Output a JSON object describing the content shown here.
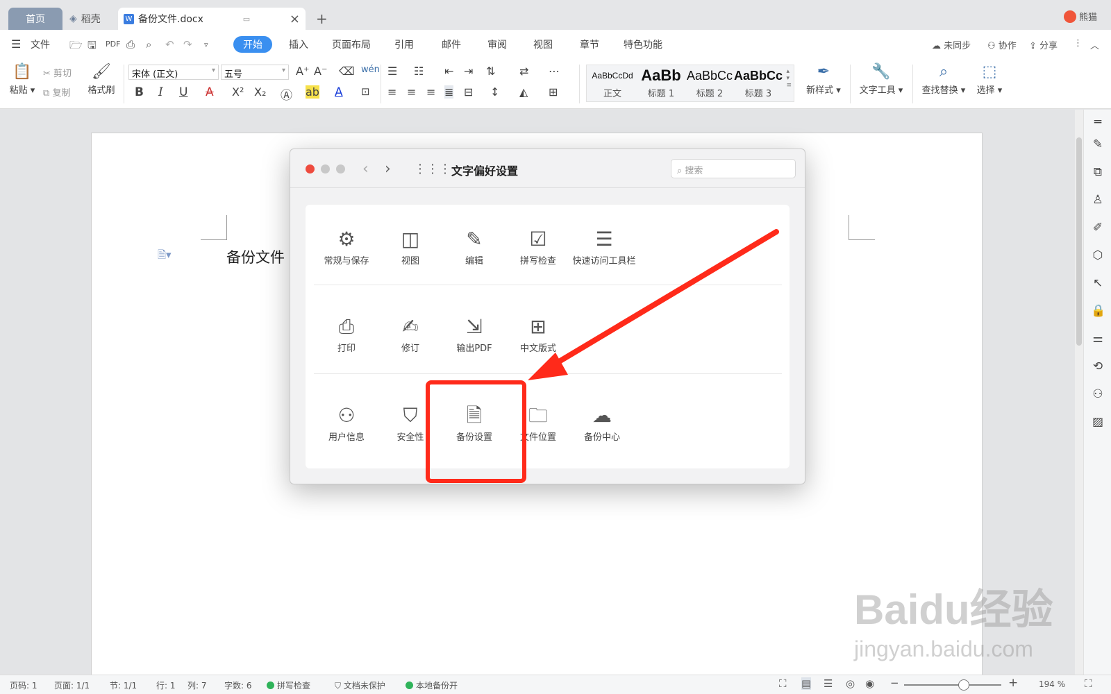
{
  "tabs": {
    "home": "首页",
    "daoke": "稻壳",
    "doc": "备份文件.docx",
    "plus": "+"
  },
  "user": {
    "name": "熊猫"
  },
  "menu": {
    "file": "文件",
    "items": [
      "开始",
      "插入",
      "页面布局",
      "引用",
      "邮件",
      "审阅",
      "视图",
      "章节",
      "特色功能"
    ],
    "right": [
      "未同步",
      "协作",
      "分享"
    ]
  },
  "ribbon": {
    "paste": "粘贴",
    "cut": "剪切",
    "copy": "复制",
    "format_painter": "格式刷",
    "font_name": "宋体 (正文)",
    "font_size": "五号",
    "styles": [
      {
        "sample": "AaBbCcDd",
        "label": "正文"
      },
      {
        "sample": "AaBb",
        "label": "标题 1"
      },
      {
        "sample": "AaBbCc",
        "label": "标题 2"
      },
      {
        "sample": "AaBbCc",
        "label": "标题 3"
      }
    ],
    "new_style": "新样式",
    "text_tools": "文字工具",
    "find_replace": "查找替换",
    "select": "选择"
  },
  "document": {
    "text": "备份文件"
  },
  "dialog": {
    "title": "文字偏好设置",
    "search_placeholder": "搜索",
    "rows": [
      [
        {
          "icon": "gear-icon",
          "glyph": "⚙",
          "label": "常规与保存"
        },
        {
          "icon": "layout-icon",
          "glyph": "◫",
          "label": "视图"
        },
        {
          "icon": "pencil-icon",
          "glyph": "✎",
          "label": "编辑"
        },
        {
          "icon": "check-box-icon",
          "glyph": "☑",
          "label": "拼写检查"
        },
        {
          "icon": "toolbar-icon",
          "glyph": "☰",
          "label": "快速访问工具栏"
        }
      ],
      [
        {
          "icon": "printer-icon",
          "glyph": "⎙",
          "label": "打印"
        },
        {
          "icon": "revise-icon",
          "glyph": "✍",
          "label": "修订"
        },
        {
          "icon": "pdf-export-icon",
          "glyph": "⇲",
          "label": "输出PDF"
        },
        {
          "icon": "chinese-layout-icon",
          "glyph": "⊞",
          "label": "中文版式"
        }
      ],
      [
        {
          "icon": "user-icon",
          "glyph": "⚇",
          "label": "用户信息"
        },
        {
          "icon": "shield-icon",
          "glyph": "⛉",
          "label": "安全性"
        },
        {
          "icon": "backup-file-icon",
          "glyph": "🗎",
          "label": "备份设置"
        },
        {
          "icon": "folder-location-icon",
          "glyph": "🗀",
          "label": "文件位置"
        },
        {
          "icon": "backup-center-icon",
          "glyph": "☁",
          "label": "备份中心"
        }
      ]
    ]
  },
  "status": {
    "page_code": "页码: 1",
    "page": "页面: 1/1",
    "section": "节: 1/1",
    "line": "行: 1",
    "col": "列: 7",
    "words": "字数: 6",
    "spell": "拼写检查",
    "protect": "文档未保护",
    "backup": "本地备份开",
    "zoom": "194 %"
  },
  "watermark": {
    "line1": "Baidu经验",
    "line2": "jingyan.baidu.com"
  },
  "colors": {
    "accent": "#3a8ff0",
    "highlight": "#ff2a1a"
  }
}
